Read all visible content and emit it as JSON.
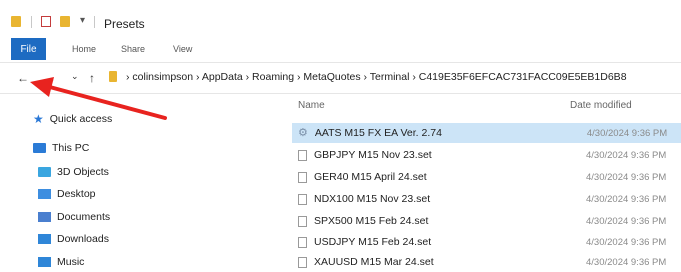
{
  "window": {
    "title": "Presets"
  },
  "ribbon": {
    "file_label": "File",
    "tabs": [
      "Home",
      "Share",
      "View"
    ]
  },
  "address": {
    "back_glyph": "←",
    "forward_glyph": "→",
    "recent_glyph": "⌄",
    "up_glyph": "↑",
    "path_text": "› colinsimpson › AppData › Roaming › MetaQuotes › Terminal › C419E35F6EFCAC731FACC09E5EB1D6B8"
  },
  "sidebar": {
    "items": [
      {
        "label": "Quick access",
        "icon": "star-icon"
      },
      {
        "label": "This PC",
        "icon": "computer-icon"
      },
      {
        "label": "3D Objects",
        "icon": "3d-objects-icon"
      },
      {
        "label": "Desktop",
        "icon": "desktop-icon"
      },
      {
        "label": "Documents",
        "icon": "documents-icon"
      },
      {
        "label": "Downloads",
        "icon": "downloads-icon"
      },
      {
        "label": "Music",
        "icon": "music-icon"
      }
    ]
  },
  "list": {
    "columns": {
      "name": "Name",
      "date": "Date modified"
    },
    "files": [
      {
        "name": "AATS M15 FX EA Ver. 2.74",
        "date": "4/30/2024 9:36 PM",
        "selected": true,
        "icon": "application-icon"
      },
      {
        "name": "GBPJPY M15 Nov 23.set",
        "date": "4/30/2024 9:36 PM",
        "icon": "file-icon"
      },
      {
        "name": "GER40 M15 April 24.set",
        "date": "4/30/2024 9:36 PM",
        "icon": "file-icon"
      },
      {
        "name": "NDX100 M15 Nov 23.set",
        "date": "4/30/2024 9:36 PM",
        "icon": "file-icon"
      },
      {
        "name": "SPX500 M15 Feb 24.set",
        "date": "4/30/2024 9:36 PM",
        "icon": "file-icon"
      },
      {
        "name": "USDJPY M15 Feb 24.set",
        "date": "4/30/2024 9:36 PM",
        "icon": "file-icon"
      },
      {
        "name": "XAUUSD M15  Mar 24.set",
        "date": "4/30/2024 9:36 PM",
        "icon": "file-icon"
      }
    ]
  },
  "annotation": {
    "arrow_color": "#e8231f"
  },
  "colors": {
    "accent": "#1d6bc2",
    "selection": "#cce4f7",
    "folder": "#e9b531"
  }
}
